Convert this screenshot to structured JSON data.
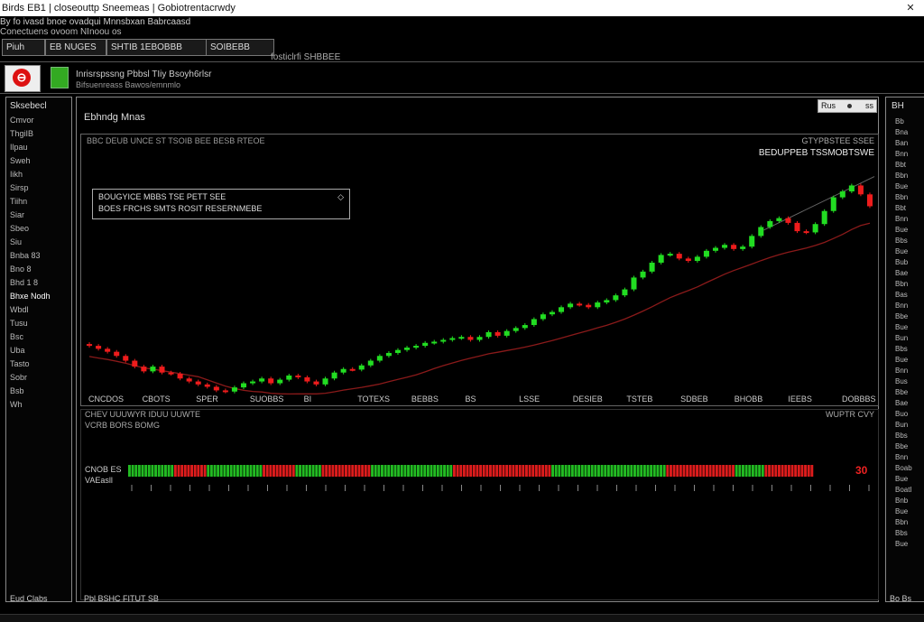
{
  "window": {
    "title": "Birds EB1 | closeouttp Sneemeas | Gobiotrentacrwdy",
    "sub_line1": "By fo ivasd bnoe ovadqui Mnnsbxan Babrcaasd",
    "sub_line2": "Conectuens ovoom NInoou os"
  },
  "tabs": [
    {
      "label": "Piuh"
    },
    {
      "label": "EB NUGES"
    },
    {
      "label": "SHTIB 1EBOBBB"
    },
    {
      "label": "SOIBEBB"
    }
  ],
  "tab_hint": "fosticlrfi SHBBEE",
  "header": {
    "app_text": "Inrisrspssng  Pbbsl  TIiy Bsoyh6rlsr",
    "app_sub": "Bifsuenreass  Bawos/emnmlo"
  },
  "left_panel": {
    "title": "Sksebecl",
    "items": [
      "Cmvor",
      "ThgiIB",
      "Ilpau",
      "Sweh",
      "Iikh",
      "Sirsp",
      "Tiihn",
      "Siar",
      "Sbeo",
      "Siu",
      "Bnba 83",
      "Bno 8",
      "Bhd 1 8",
      "Bhxe Nodh",
      "Wbdl",
      "Tusu",
      "Bsc",
      "Uba",
      "Tasto",
      "Sobr",
      "Bsb",
      "Wh"
    ],
    "footer": "Eud  Clabs"
  },
  "main": {
    "title": "Ebhndg Mnas",
    "reset_label_a": "Rus",
    "reset_label_b": "ss",
    "chart_header": "BBC DEUB UNCE ST TSOIB BEE  BESB RTEOE",
    "chart_top_right_a": "GTYPBSTEE SSEE",
    "chart_top_right_b": "BEDUPPEB TSSMOBTSWE",
    "info_line1": "BOUGYICE   MBBS   TSE   PETT  SEE",
    "info_line2": "BOES FRCHS SMTS ROSIT RESERNMEBE",
    "info_icon": "◇",
    "sub_title1": "CHEV UUUWYR IDUU UUWTE",
    "sub_title2": "VCRB BORS BOMG",
    "sub_right": "WUPTR CVY",
    "bar_label1": "CNOB  ES",
    "bar_label2": "VAEasll",
    "bar_value": "30",
    "footer": "Pbl  BSHC FITUT SB"
  },
  "right_panel": {
    "title": "BH",
    "items": [
      "Bb",
      "Bna",
      "Ban",
      "Bnn",
      "Bbt",
      "Bbn",
      "Bue",
      "Bbn",
      "Bbt",
      "Bnn",
      "Bue",
      "Bbs",
      "Bue",
      "Bub",
      "Bae",
      "Bbn",
      "Bas",
      "Bnn",
      "Bbe",
      "Bue",
      "Bun",
      "Bbs",
      "Bue",
      "Bnn",
      "Bus",
      "Bbe",
      "Bae",
      "Buo",
      "Bun",
      "Bbs",
      "Bbe",
      "Bnn",
      "Boab",
      "Bue",
      "Boatl",
      "Bnb",
      "Bue",
      "Bbn",
      "Bbs",
      "Bue"
    ],
    "footer": "Bo  Bs"
  },
  "chart_data": {
    "type": "candlestick",
    "x_labels": [
      "CNCDOS",
      "CBOTS",
      "SPER",
      "SUOBBS",
      "BI",
      "TOTEXS",
      "BEBBS",
      "BS",
      "LSSE",
      "DESIEB",
      "TSTEB",
      "SDBEB",
      "BHOBB",
      "IEEBS",
      "DOBBBS"
    ],
    "up_color": "#22dd22",
    "down_color": "#ee1c1c",
    "ma_color": "#8a1a1a",
    "close_series": [
      405,
      400,
      395,
      388,
      380,
      370,
      362,
      370,
      360,
      358,
      350,
      345,
      340,
      336,
      330,
      328,
      335,
      342,
      345,
      350,
      342,
      348,
      355,
      352,
      345,
      340,
      350,
      360,
      366,
      365,
      372,
      380,
      388,
      393,
      398,
      402,
      405,
      410,
      412,
      415,
      418,
      420,
      415,
      420,
      428,
      422,
      430,
      435,
      440,
      450,
      458,
      462,
      470,
      476,
      474,
      470,
      478,
      482,
      490,
      500,
      520,
      530,
      545,
      558,
      560,
      552,
      548,
      555,
      565,
      570,
      575,
      568,
      572,
      590,
      605,
      615,
      620,
      612,
      598,
      596,
      610,
      632,
      655,
      665,
      675,
      660,
      640
    ],
    "volume_bars_colors": [
      "g",
      "g",
      "g",
      "g",
      "g",
      "g",
      "g",
      "g",
      "g",
      "g",
      "g",
      "g",
      "g",
      "g",
      "r",
      "r",
      "r",
      "r",
      "r",
      "r",
      "r",
      "r",
      "r",
      "r",
      "g",
      "g",
      "g",
      "g",
      "g",
      "g",
      "g",
      "g",
      "g",
      "g",
      "g",
      "g",
      "g",
      "g",
      "g",
      "g",
      "g",
      "r",
      "r",
      "r",
      "r",
      "r",
      "r",
      "r",
      "r",
      "r",
      "r",
      "g",
      "g",
      "g",
      "g",
      "g",
      "g",
      "g",
      "g",
      "r",
      "r",
      "r",
      "r",
      "r",
      "r",
      "r",
      "r",
      "r",
      "r",
      "r",
      "r",
      "r",
      "r",
      "r",
      "g",
      "g",
      "g",
      "g",
      "g",
      "g",
      "g",
      "g",
      "g",
      "g",
      "g",
      "g",
      "g",
      "g",
      "g",
      "g",
      "g",
      "g",
      "g",
      "g",
      "g",
      "g",
      "g",
      "g",
      "g",
      "r",
      "r",
      "r",
      "r",
      "r",
      "r",
      "r",
      "r",
      "r",
      "r",
      "r",
      "r",
      "r",
      "r",
      "r",
      "r",
      "r",
      "r",
      "r",
      "r",
      "r",
      "r",
      "r",
      "r",
      "r",
      "r",
      "r",
      "r",
      "r",
      "r",
      "g",
      "g",
      "g",
      "g",
      "g",
      "g",
      "g",
      "g",
      "g",
      "g",
      "g",
      "g",
      "g",
      "g",
      "g",
      "g",
      "g",
      "g",
      "g",
      "g",
      "g",
      "g",
      "g",
      "g",
      "g",
      "g",
      "g",
      "g",
      "g",
      "g",
      "g",
      "g",
      "g",
      "g",
      "g",
      "r",
      "r",
      "r",
      "r",
      "r",
      "r",
      "r",
      "r",
      "r",
      "r",
      "r",
      "r",
      "r",
      "r",
      "r",
      "r",
      "r",
      "r",
      "r",
      "r",
      "r",
      "g",
      "g",
      "g",
      "g",
      "g",
      "g",
      "g",
      "g",
      "g",
      "r",
      "r",
      "r",
      "r",
      "r",
      "r",
      "r",
      "r",
      "r",
      "r",
      "r",
      "r",
      "r",
      "r",
      "r"
    ]
  }
}
